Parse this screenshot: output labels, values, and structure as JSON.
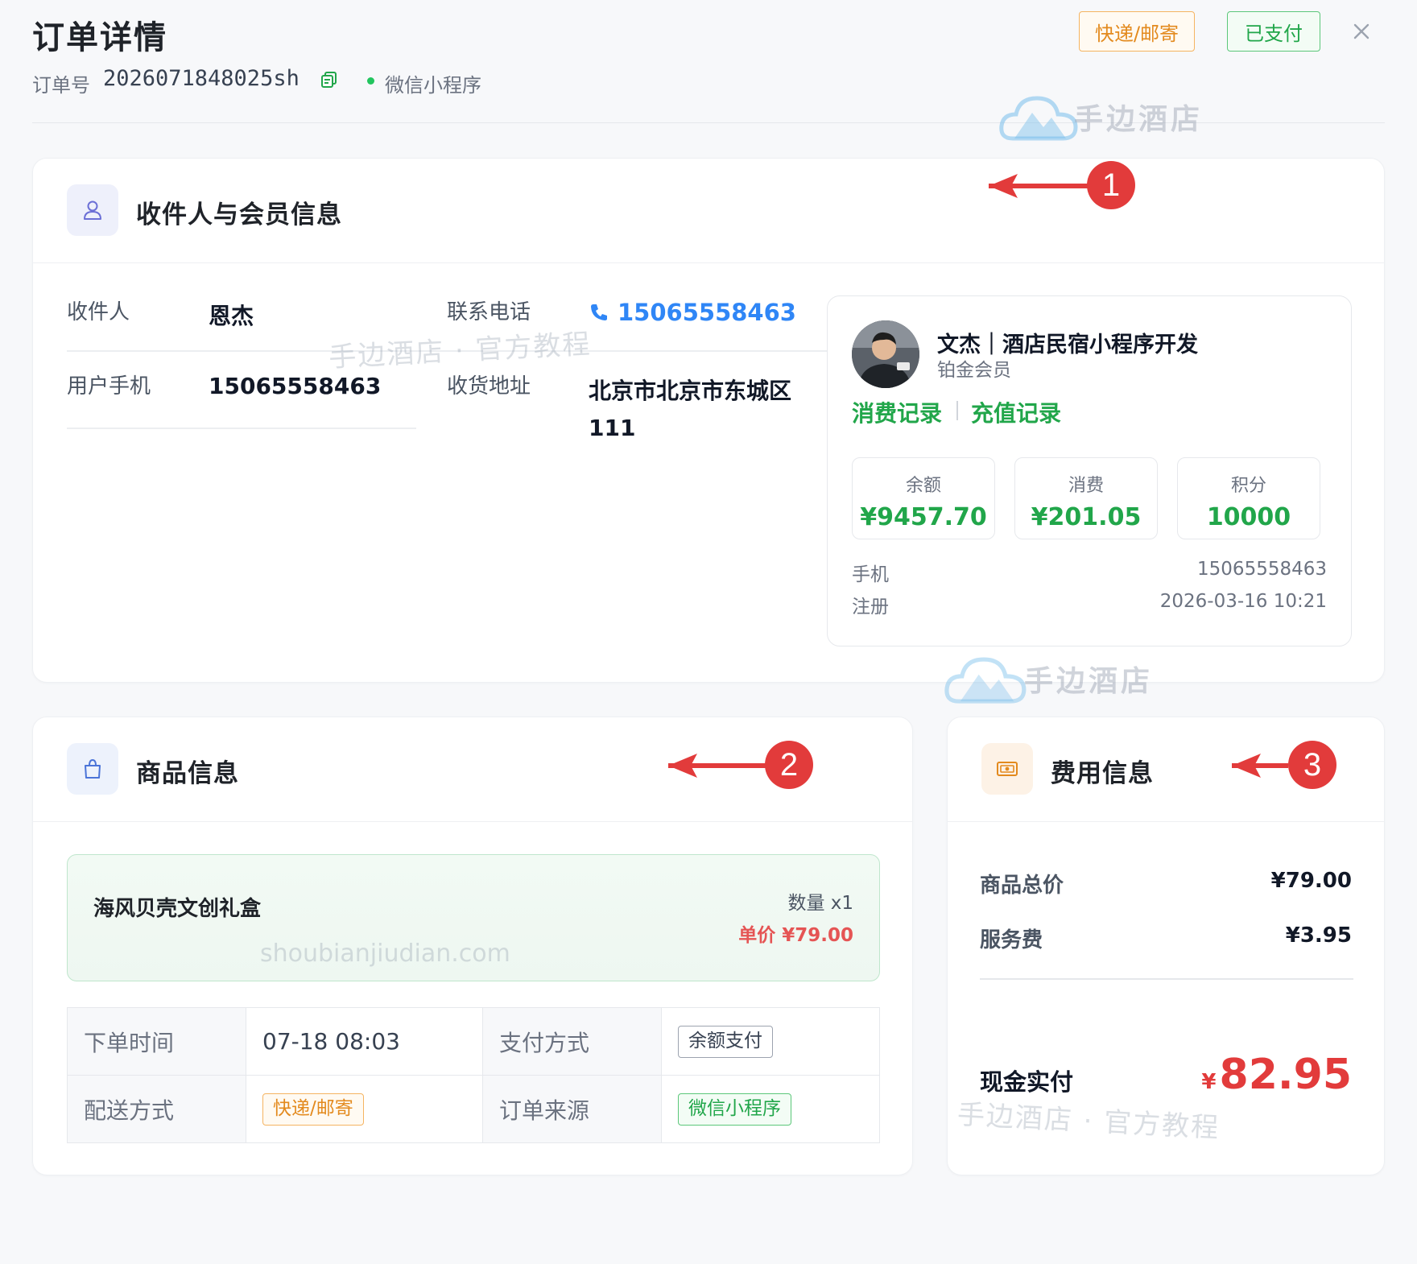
{
  "header": {
    "title": "订单详情",
    "order_no_label": "订单号",
    "order_no": "2026071848025sh",
    "source": "微信小程序",
    "tag_delivery": "快递/邮寄",
    "tag_status": "已支付"
  },
  "recipient_card": {
    "title": "收件人与会员信息",
    "recipient_label": "收件人",
    "recipient_value": "恩杰",
    "contact_label": "联系电话",
    "contact_value": "15065558463",
    "user_phone_label": "用户手机",
    "user_phone_value": "15065558463",
    "address_label": "收货地址",
    "address_value": "北京市北京市东城区\n111"
  },
  "member": {
    "name": "文杰｜酒店民宿小程序开发",
    "level": "铂金会员",
    "link_consume": "消费记录",
    "link_recharge": "充值记录",
    "stats": [
      {
        "label": "余额",
        "value": "¥9457.70"
      },
      {
        "label": "消费",
        "value": "¥201.05"
      },
      {
        "label": "积分",
        "value": "10000"
      }
    ],
    "phone_label": "手机",
    "phone_value": "15065558463",
    "register_label": "注册",
    "register_value": "2026-03-16 10:21"
  },
  "product_card": {
    "title": "商品信息",
    "product_name": "海风贝壳文创礼盒",
    "quantity": "数量 x1",
    "unit_price": "单价 ¥79.00",
    "rows": {
      "order_time_label": "下单时间",
      "order_time_value": "07-18 08:03",
      "pay_method_label": "支付方式",
      "pay_method_value": "余额支付",
      "delivery_label": "配送方式",
      "delivery_value": "快递/邮寄",
      "source_label": "订单来源",
      "source_value": "微信小程序"
    }
  },
  "fee_card": {
    "title": "费用信息",
    "goods_total_label": "商品总价",
    "goods_total_value": "¥79.00",
    "service_fee_label": "服务费",
    "service_fee_value": "¥3.95",
    "paid_label": "现金实付",
    "paid_currency": "¥",
    "paid_value": "82.95"
  },
  "annotations": {
    "badge_1": "1",
    "badge_2": "2",
    "badge_3": "3"
  },
  "watermarks": {
    "logo_text": "手边酒店",
    "text_1": "手边酒店 · 官方教程",
    "text_2": "shoubianjiudian.com",
    "text_3": "手边酒店 · 官方教程"
  },
  "colors": {
    "green_accent": "#21a64a",
    "orange_accent": "#e38a1e",
    "red_price": "#e23b3b",
    "blue_link": "#2f86f6"
  }
}
